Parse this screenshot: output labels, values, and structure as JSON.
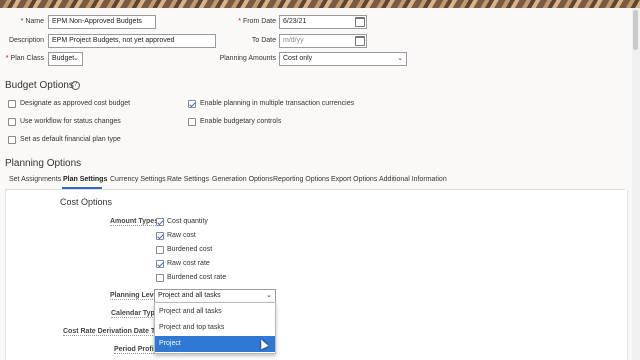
{
  "header": {
    "name_label": "Name",
    "name_value": "EPM Non-Approved Budgets",
    "description_label": "Description",
    "description_value": "EPM Project Budgets, not yet approved",
    "plan_class_label": "Plan Class",
    "plan_class_value": "Budget",
    "from_date_label": "From Date",
    "from_date_value": "6/23/21",
    "to_date_label": "To Date",
    "to_date_placeholder": "m/d/yy",
    "planning_amounts_label": "Planning Amounts",
    "planning_amounts_value": "Cost only"
  },
  "budget_options": {
    "title": "Budget Options",
    "help": "?",
    "items": [
      {
        "label": "Designate as approved cost budget",
        "checked": false
      },
      {
        "label": "Enable planning in multiple transaction currencies",
        "checked": true
      },
      {
        "label": "Use workflow for status changes",
        "checked": false
      },
      {
        "label": "Enable budgetary controls",
        "checked": false
      },
      {
        "label": "Set as default financial plan type",
        "checked": false
      }
    ]
  },
  "planning_options": {
    "title": "Planning Options",
    "tabs": [
      {
        "label": "Set Assignments",
        "active": false
      },
      {
        "label": "Plan Settings",
        "active": true
      },
      {
        "label": "Currency Settings",
        "active": false
      },
      {
        "label": "Rate Settings",
        "active": false
      },
      {
        "label": "Generation Options",
        "active": false
      },
      {
        "label": "Reporting Options",
        "active": false
      },
      {
        "label": "Export Options",
        "active": false
      },
      {
        "label": "Additional Information",
        "active": false
      }
    ]
  },
  "cost_options": {
    "title": "Cost Options",
    "amount_types_label": "Amount Types",
    "amount_types": [
      {
        "label": "Cost quantity",
        "checked": true
      },
      {
        "label": "Raw cost",
        "checked": true
      },
      {
        "label": "Burdened cost",
        "checked": false
      },
      {
        "label": "Raw cost rate",
        "checked": true
      },
      {
        "label": "Burdened cost rate",
        "checked": false
      }
    ],
    "planning_level_label": "Planning Level",
    "planning_level_value": "Project and all tasks",
    "calendar_type_label": "Calendar Type",
    "cost_rate_label": "Cost Rate Derivation Date Type",
    "period_profile_label": "Period Profile",
    "dropdown_options": [
      {
        "label": "Project and all tasks",
        "selected": false
      },
      {
        "label": "Project and top tasks",
        "selected": false
      },
      {
        "label": "Project",
        "selected": true
      }
    ]
  },
  "colors": {
    "accent": "#2a6dc2",
    "selected_bg": "#2f78d4",
    "required": "#cc0000"
  }
}
